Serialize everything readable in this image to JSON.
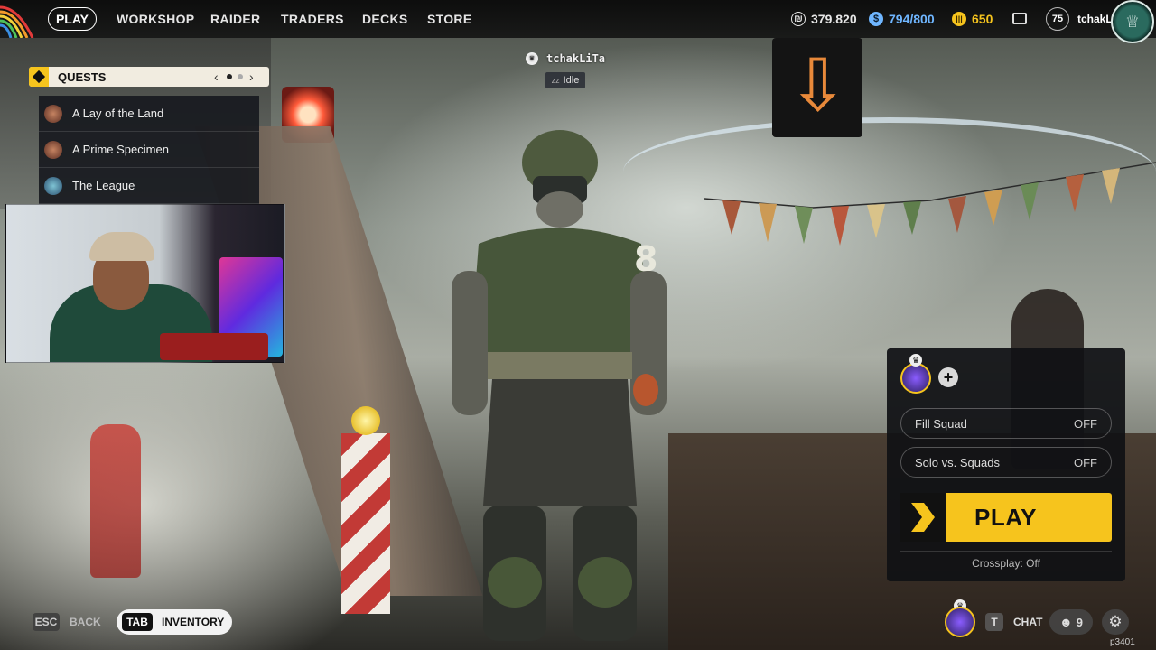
{
  "nav": {
    "play": "PLAY",
    "items": [
      "WORKSHOP",
      "RAIDER",
      "TRADERS",
      "DECKS",
      "STORE"
    ]
  },
  "currencies": [
    {
      "icon": "coin-icon",
      "value": "379.820",
      "color": "#e6e6e6"
    },
    {
      "icon": "raider-token-icon",
      "value": "794/800",
      "color": "#6fb6ff"
    },
    {
      "icon": "cred-icon",
      "value": "650",
      "color": "#f6c41d"
    }
  ],
  "profile": {
    "level": "75",
    "name": "tchakLi"
  },
  "quests": {
    "title": "QUESTS",
    "items": [
      "A Lay of the Land",
      "A Prime Specimen",
      "The League"
    ]
  },
  "player_tag": {
    "name": "tchakLiTa",
    "status": "Idle"
  },
  "squad": {
    "fill_squad": {
      "label": "Fill Squad",
      "value": "OFF"
    },
    "solo_vs_squads": {
      "label": "Solo vs. Squads",
      "value": "OFF"
    },
    "play": "PLAY",
    "crossplay": "Crossplay: Off"
  },
  "bottom": {
    "esc_key": "ESC",
    "back": "BACK",
    "tab_key": "TAB",
    "inventory": "INVENTORY",
    "chat_key": "T",
    "chat": "CHAT",
    "friends_count": "9",
    "build": "p3401"
  },
  "colors": {
    "accent": "#f6c41d",
    "panel": "#101114",
    "header_bg": "#f1ece0"
  }
}
